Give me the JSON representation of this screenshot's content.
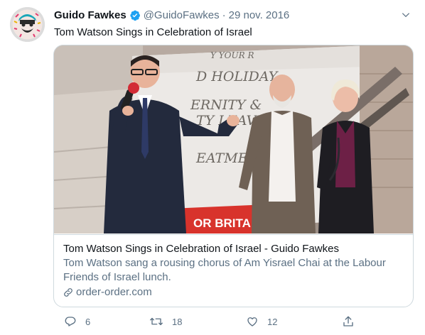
{
  "tweet": {
    "author_name": "Guido Fawkes",
    "handle": "@GuidoFawkes",
    "separator": "·",
    "date": "29 nov. 2016",
    "text": "Tom Watson Sings in Celebration of Israel"
  },
  "card": {
    "title": "Tom Watson Sings in Celebration of Israel - Guido Fawkes",
    "description": "Tom Watson sang a rousing chorus of Am Yisrael Chai at the Labour Friends of Israel lunch.",
    "domain": "order-order.com",
    "banner_text": {
      "line1": "Y YOUR R",
      "line2": "D HOLIDAY",
      "line3": "ERNITY &",
      "line4": "TY LEAVE",
      "line5": "EATMENT",
      "line6": "OR BRITA"
    }
  },
  "actions": {
    "reply_count": "6",
    "retweet_count": "18",
    "like_count": "12"
  },
  "icons": {
    "verified": "verified-badge-icon",
    "more": "chevron-down-icon",
    "link": "link-icon",
    "reply": "reply-icon",
    "retweet": "retweet-icon",
    "like": "heart-icon",
    "share": "share-icon"
  },
  "colors": {
    "verified_blue": "#1da1f2",
    "secondary_text": "#5b7083",
    "primary_text": "#0f1419",
    "border": "#cfd9de",
    "banner_red": "#d8332c"
  }
}
